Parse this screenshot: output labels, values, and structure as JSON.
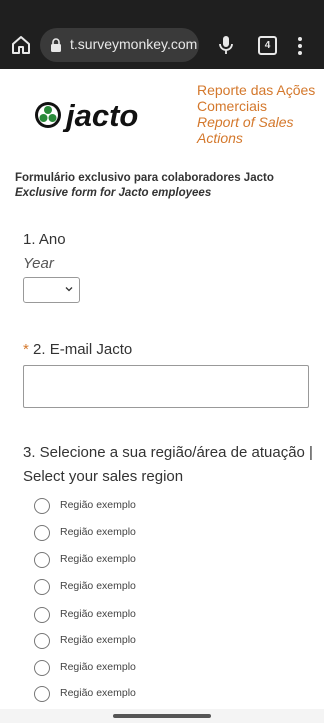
{
  "browser": {
    "url": "t.surveymonkey.com",
    "tab_count": "4"
  },
  "header": {
    "logo_text": "jacto",
    "title_pt": "Reporte das Ações Comerciais",
    "title_en": "Report of Sales Actions"
  },
  "intro": {
    "pt": "Formulário exclusivo para colaboradores Jacto",
    "en": "Exclusive form for Jacto employees"
  },
  "questions": {
    "q1": {
      "title": "1. Ano",
      "subtitle": "Year",
      "selected": ""
    },
    "q2": {
      "required_mark": "*",
      "title": "2. E-mail Jacto",
      "value": ""
    },
    "q3": {
      "title": "3. Selecione a sua região/área de atuação | Select your sales region",
      "options": [
        "Região exemplo",
        "Região exemplo",
        "Região exemplo",
        "Região exemplo",
        "Região exemplo",
        "Região exemplo",
        "Região exemplo",
        "Região exemplo"
      ]
    }
  },
  "colors": {
    "accent": "#d4782c",
    "browser_bar": "#1f1f1f",
    "logo_green": "#2a8a3a"
  }
}
